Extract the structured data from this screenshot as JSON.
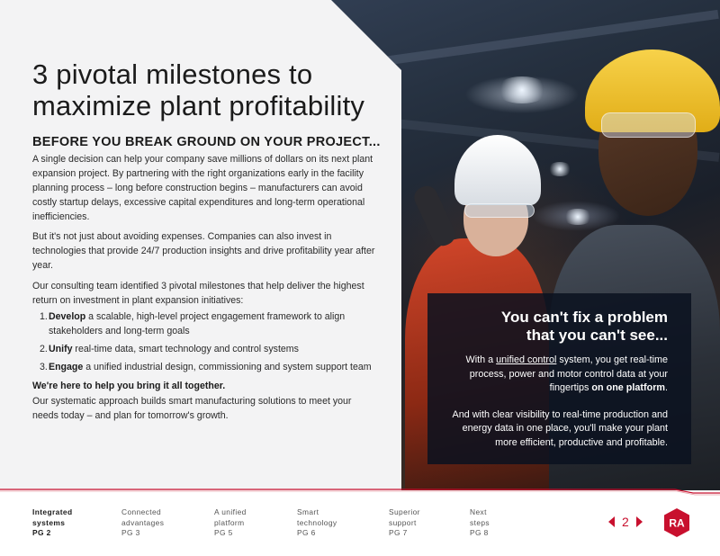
{
  "page": {
    "title": "3 pivotal milestones to maximize plant profitability",
    "subhead": "BEFORE YOU BREAK GROUND ON YOUR PROJECT...",
    "paragraph1": "A single decision can help your company save millions of dollars on its next plant expansion project. By partnering with the right organizations early in the facility planning process – long before construction begins – manufacturers can avoid costly startup delays, excessive capital expenditures and long-term operational inefficiencies.",
    "paragraph2": "But it's not just about avoiding expenses. Companies can also invest in technologies that provide 24/7 production insights and drive profitability year after year.",
    "paragraph3": "Our consulting team identified 3 pivotal milestones that help deliver the highest return on investment in plant expansion initiatives:",
    "milestones": [
      {
        "num": "1.",
        "bold": "Develop",
        "rest": " a scalable, high-level project engagement framework to align stakeholders and long-term goals"
      },
      {
        "num": "2.",
        "bold": "Unify",
        "rest": " real-time data, smart technology and control systems"
      },
      {
        "num": "3.",
        "bold": "Engage",
        "rest": " a unified industrial design, commissioning and system support team"
      }
    ],
    "closing_head": "We're here to help you bring it all together.",
    "closing": "Our systematic approach builds smart manufacturing solutions to meet your needs today – and plan for tomorrow's growth."
  },
  "callout": {
    "title_line1": "You can't fix a problem",
    "title_line2": "that you can't see...",
    "p1_a": "With a ",
    "p1_link": "unified control",
    "p1_b": " system, you get real-time process, power and motor control data at your fingertips ",
    "p1_bold": "on one platform",
    "p1_end": ".",
    "p2": "And with clear visibility to real-time production and energy data in one place, you'll make your plant more efficient, productive and profitable."
  },
  "footer": {
    "nav": [
      {
        "line1": "Integrated",
        "line2": "systems",
        "page": "PG 2",
        "active": true
      },
      {
        "line1": "Connected",
        "line2": "advantages",
        "page": "PG 3",
        "active": false
      },
      {
        "line1": "A unified",
        "line2": "platform",
        "page": "PG 5",
        "active": false
      },
      {
        "line1": "Smart",
        "line2": "technology",
        "page": "PG 6",
        "active": false
      },
      {
        "line1": "Superior",
        "line2": "support",
        "page": "PG 7",
        "active": false
      },
      {
        "line1": "Next",
        "line2": "steps",
        "page": "PG 8",
        "active": false
      }
    ],
    "current_page": "2",
    "logo_text": "RA"
  },
  "colors": {
    "brand_red": "#c8102e",
    "panel_gray": "#f3f3f4",
    "callout_bg": "#0a1220"
  },
  "icons": [
    "arrow-left-icon",
    "arrow-right-icon",
    "rockwell-logo"
  ]
}
